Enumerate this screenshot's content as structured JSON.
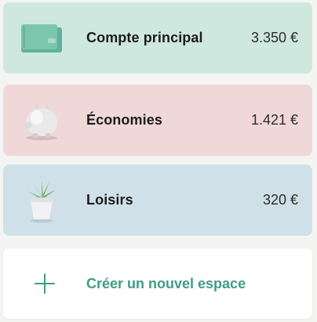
{
  "spaces": [
    {
      "name": "Compte principal",
      "amount": "3.350 €",
      "illustration": "wallet-icon"
    },
    {
      "name": "Économies",
      "amount": "1.421 €",
      "illustration": "piggy-bank-icon"
    },
    {
      "name": "Loisirs",
      "amount": "320 €",
      "illustration": "potted-plant-icon"
    }
  ],
  "create": {
    "label": "Créer un nouvel espace",
    "icon": "plus-icon"
  },
  "colors": {
    "main_card": "#cfe8df",
    "savings_card": "#f0d8d9",
    "leisure_card": "#cfe0e8",
    "accent": "#3f9c84"
  }
}
